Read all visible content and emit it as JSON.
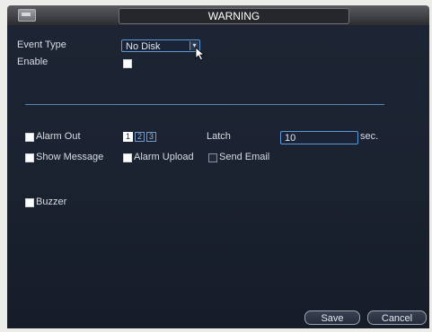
{
  "window": {
    "title": "WARNING"
  },
  "form": {
    "event_type_label": "Event Type",
    "event_type_value": "No Disk",
    "enable_label": "Enable",
    "alarm_out_label": "Alarm Out",
    "channels": [
      "1",
      "2",
      "3"
    ],
    "latch_label": "Latch",
    "latch_value": "10",
    "latch_unit": "sec.",
    "show_message_label": "Show Message",
    "alarm_upload_label": "Alarm Upload",
    "send_email_label": "Send Email",
    "buzzer_label": "Buzzer"
  },
  "footer": {
    "save_label": "Save",
    "cancel_label": "Cancel"
  }
}
